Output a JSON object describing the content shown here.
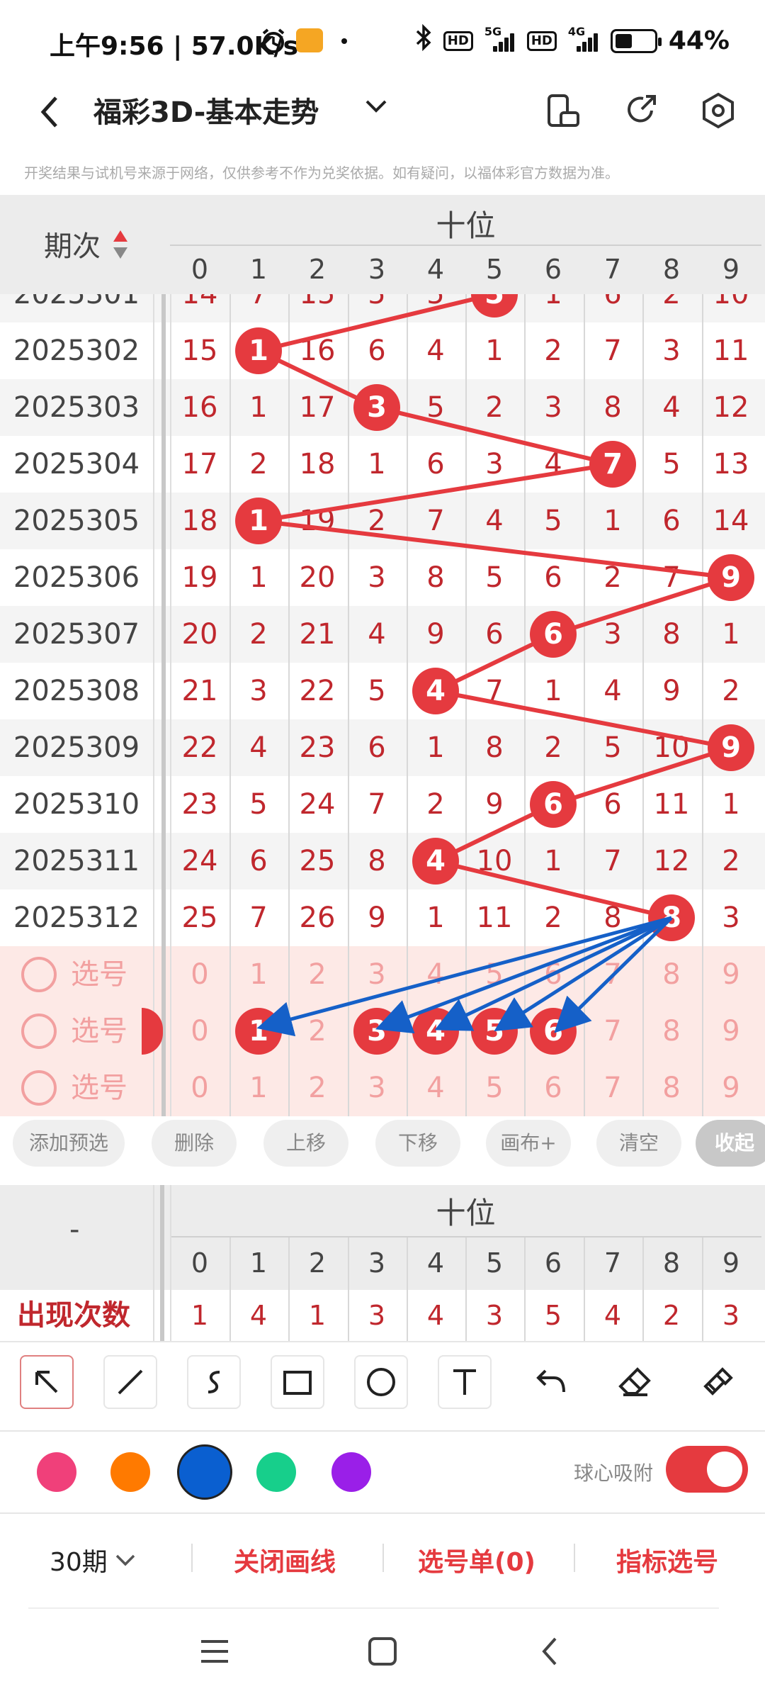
{
  "status_bar": {
    "time": "上午9:56 | 57.0K/s",
    "net1": "5G",
    "net2": "4G",
    "hd": "HD",
    "battery": "44%",
    "battery_level": 0.44
  },
  "title_bar": {
    "title": "福彩3D-基本走势"
  },
  "disclaimer": "开奖结果与试机号来源于网络，仅供参考不作为兑奖依据。如有疑问，以福体彩官方数据为准。",
  "grid": {
    "period_header": "期次",
    "section_title": "十位",
    "digits": [
      "0",
      "1",
      "2",
      "3",
      "4",
      "5",
      "6",
      "7",
      "8",
      "9"
    ],
    "partial_row": {
      "period": "2025301",
      "cells": [
        "14",
        "7",
        "15",
        "5",
        "5",
        "5",
        "1",
        "6",
        "2",
        "10"
      ]
    },
    "rows": [
      {
        "period": "2025302",
        "cells": [
          "15",
          "1",
          "16",
          "6",
          "4",
          "1",
          "2",
          "7",
          "3",
          "11"
        ],
        "hit": 1
      },
      {
        "period": "2025303",
        "cells": [
          "16",
          "1",
          "17",
          "3",
          "5",
          "2",
          "3",
          "8",
          "4",
          "12"
        ],
        "hit": 3
      },
      {
        "period": "2025304",
        "cells": [
          "17",
          "2",
          "18",
          "1",
          "6",
          "3",
          "4",
          "7",
          "5",
          "13"
        ],
        "hit": 7
      },
      {
        "period": "2025305",
        "cells": [
          "18",
          "1",
          "19",
          "2",
          "7",
          "4",
          "5",
          "1",
          "6",
          "14"
        ],
        "hit": 1
      },
      {
        "period": "2025306",
        "cells": [
          "19",
          "1",
          "20",
          "3",
          "8",
          "5",
          "6",
          "2",
          "7",
          "9"
        ],
        "hit": 9
      },
      {
        "period": "2025307",
        "cells": [
          "20",
          "2",
          "21",
          "4",
          "9",
          "6",
          "6",
          "3",
          "8",
          "1"
        ],
        "hit": 6
      },
      {
        "period": "2025308",
        "cells": [
          "21",
          "3",
          "22",
          "5",
          "4",
          "7",
          "1",
          "4",
          "9",
          "2"
        ],
        "hit": 4
      },
      {
        "period": "2025309",
        "cells": [
          "22",
          "4",
          "23",
          "6",
          "1",
          "8",
          "2",
          "5",
          "10",
          "9"
        ],
        "hit": 9
      },
      {
        "period": "2025310",
        "cells": [
          "23",
          "5",
          "24",
          "7",
          "2",
          "9",
          "6",
          "6",
          "11",
          "1"
        ],
        "hit": 6
      },
      {
        "period": "2025311",
        "cells": [
          "24",
          "6",
          "25",
          "8",
          "4",
          "10",
          "1",
          "7",
          "12",
          "2"
        ],
        "hit": 4
      },
      {
        "period": "2025312",
        "cells": [
          "25",
          "7",
          "26",
          "9",
          "1",
          "11",
          "2",
          "8",
          "8",
          "3"
        ],
        "hit": 8
      }
    ],
    "select_label": "选号",
    "select_rows": [
      {
        "cells": [
          "0",
          "1",
          "2",
          "3",
          "4",
          "5",
          "6",
          "7",
          "8",
          "9"
        ],
        "balls": []
      },
      {
        "cells": [
          "0",
          "1",
          "2",
          "3",
          "4",
          "5",
          "6",
          "7",
          "8",
          "9"
        ],
        "balls": [
          1,
          3,
          4,
          5,
          6
        ]
      },
      {
        "cells": [
          "0",
          "1",
          "2",
          "3",
          "4",
          "5",
          "6",
          "7",
          "8",
          "9"
        ],
        "balls": []
      }
    ]
  },
  "actions": {
    "add": "添加预选",
    "delete": "删除",
    "up": "上移",
    "down": "下移",
    "canvas": "画布+",
    "clear": "清空",
    "collapse": "收起"
  },
  "stats": {
    "dash": "-",
    "section_title": "十位",
    "row_label": "出现次数",
    "counts": [
      "1",
      "4",
      "1",
      "3",
      "4",
      "3",
      "5",
      "4",
      "2",
      "3"
    ]
  },
  "colors": [
    "#f0407a",
    "#ff7a00",
    "#0a5fd0",
    "#17cf8b",
    "#9a1fe8"
  ],
  "snap_label": "球心吸附",
  "snap_on": true,
  "bottom": {
    "periods": "30期",
    "close_lines": "关闭画线",
    "selection_list": "选号单(0)",
    "indicator": "指标选号"
  },
  "accent": "#e53a3f"
}
